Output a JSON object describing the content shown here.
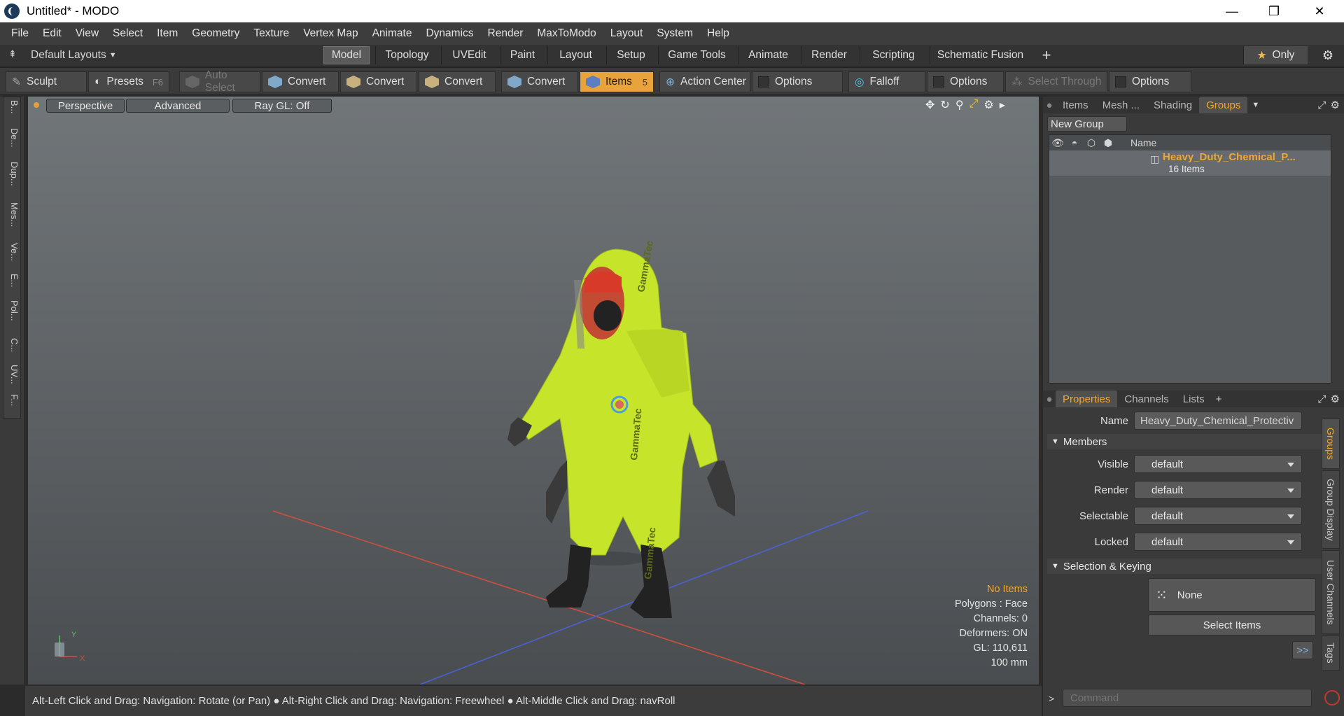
{
  "window": {
    "title": "Untitled* - MODO",
    "minimize_icon": "—",
    "maximize_icon": "❐",
    "close_icon": "✕"
  },
  "menu": [
    "File",
    "Edit",
    "View",
    "Select",
    "Item",
    "Geometry",
    "Texture",
    "Vertex Map",
    "Animate",
    "Dynamics",
    "Render",
    "MaxToModo",
    "Layout",
    "System",
    "Help"
  ],
  "layouts": {
    "label": "Default Layouts",
    "only": "Only",
    "plus": "+"
  },
  "tabs": [
    "Model",
    "Topology",
    "UVEdit",
    "Paint",
    "Layout",
    "Setup",
    "Game Tools",
    "Animate",
    "Render",
    "Scripting",
    "Schematic Fusion"
  ],
  "active_tab": "Model",
  "toolbar": {
    "sculpt": "Sculpt",
    "presets": "Presets",
    "presets_key": "F6",
    "auto_select": "Auto Select",
    "convert": "Convert",
    "items": "Items",
    "items_key": "5",
    "action_center": "Action Center",
    "options": "Options",
    "falloff": "Falloff",
    "select_through": "Select Through"
  },
  "left_tabs": [
    "B...",
    "De...",
    "Dup...",
    "Mes...",
    "Ve...",
    "E...",
    "Pol...",
    "C...",
    "UV...",
    "F..."
  ],
  "viewport": {
    "perspective": "Perspective",
    "advanced": "Advanced",
    "raygl": "Ray GL: Off",
    "info": [
      "No Items",
      "Polygons : Face",
      "Channels: 0",
      "Deformers: ON",
      "GL: 110,611",
      "100 mm"
    ],
    "axis_y": "Y",
    "axis_x": "X",
    "suit_label": "GammaTec"
  },
  "status": "Alt-Left Click and Drag: Navigation: Rotate (or Pan) ● Alt-Right Click and Drag: Navigation: Freewheel ● Alt-Middle Click and Drag: navRoll",
  "groups_panel": {
    "tabs": [
      "Items",
      "Mesh ...",
      "Shading",
      "Groups"
    ],
    "active": "Groups",
    "new_group": "New Group",
    "col_name": "Name",
    "group_name": "Heavy_Duty_Chemical_P...",
    "group_count": "16 Items"
  },
  "properties_panel": {
    "tabs": [
      "Properties",
      "Channels",
      "Lists"
    ],
    "active": "Properties",
    "name_label": "Name",
    "name_value": "Heavy_Duty_Chemical_Protectiv",
    "members": "Members",
    "rows": [
      {
        "label": "Visible",
        "value": "default"
      },
      {
        "label": "Render",
        "value": "default"
      },
      {
        "label": "Selectable",
        "value": "default"
      },
      {
        "label": "Locked",
        "value": "default"
      }
    ],
    "selection_keying": "Selection & Keying",
    "none": "None",
    "select_items": "Select Items",
    "more": ">>",
    "side_tabs": [
      "Groups",
      "Group Display",
      "User Channels",
      "Tags"
    ]
  },
  "command_placeholder": "Command",
  "colors": {
    "accent": "#f0a732",
    "suit": "#c6e52a"
  }
}
